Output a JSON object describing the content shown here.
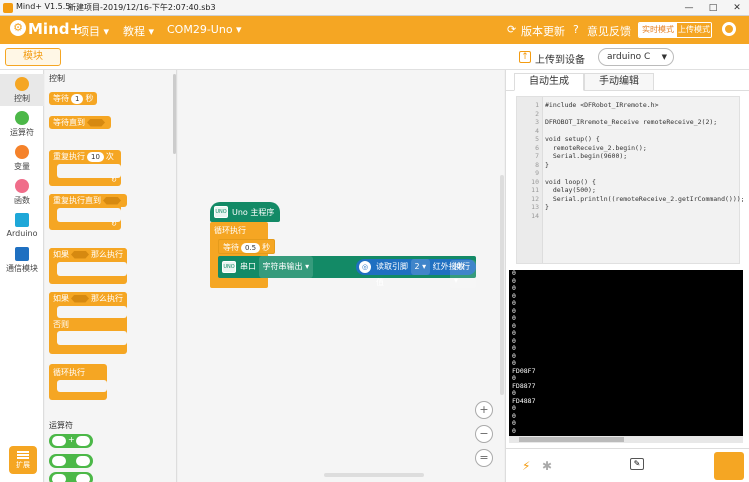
{
  "titlebar": {
    "app": "Mind+ V1.5.5",
    "project": "新建项目-2019/12/16-下午2:07:40.sb3",
    "min": "—",
    "max": "□",
    "close": "✕"
  },
  "menubar": {
    "logo": "Mind+",
    "project_menu": "项目 ▾",
    "tutorial_menu": "教程 ▾",
    "port_menu": "COM29-Uno ▾",
    "update": "版本更新",
    "feedback": "意见反馈",
    "mode_realtime": "实时模式",
    "mode_upload": "上传模式"
  },
  "subbar": {
    "module_tab": "模块",
    "upload": "上传到设备",
    "board": "arduino C"
  },
  "categories": [
    {
      "label": "控制",
      "color": "#f5a623"
    },
    {
      "label": "运算符",
      "color": "#4cb848"
    },
    {
      "label": "变量",
      "color": "#f5822a"
    },
    {
      "label": "函数",
      "color": "#f06d8a"
    },
    {
      "label": "Arduino",
      "color": "#1ea7d8"
    },
    {
      "label": "通信模块",
      "color": "#1f70c1"
    }
  ],
  "extension": "扩展",
  "palette": {
    "section_control": "控制",
    "wait": "等待",
    "wait_value": "1",
    "wait_unit": "秒",
    "wait_until": "等待直到",
    "repeat": "重复执行",
    "repeat_value": "10",
    "repeat_unit": "次",
    "repeat_until": "重复执行直到",
    "if_then": "如果",
    "then": "那么执行",
    "if_else_if": "如果",
    "else_then": "那么执行",
    "else": "否则",
    "forever": "循环执行",
    "section_operators": "运算符",
    "op_plus": "+"
  },
  "workspace": {
    "main_hat": "Uno 主程序",
    "forever": "循环执行",
    "wait": "等待",
    "wait_value": "0.5",
    "wait_unit": "秒",
    "serial": "串口",
    "serial_output": "字符串输出 ▾",
    "ir_read": "读取引脚",
    "ir_pin": "2 ▾",
    "ir_recv": "红外接收值",
    "newline": "换行 ▾",
    "zoom_in": "+",
    "zoom_out": "−",
    "zoom_reset": "="
  },
  "right_panel": {
    "tab_auto": "自动生成",
    "tab_manual": "手动编辑",
    "code_lines": [
      "#include <DFRobot_IRremote.h>",
      "",
      "DFROBOT_IRremote_Receive remoteReceive_2(2);",
      "",
      "void setup() {",
      "  remoteReceive_2.begin();",
      "  Serial.begin(9600);",
      "}",
      "",
      "void loop() {",
      "  delay(500);",
      "  Serial.println((remoteReceive_2.getIrCommand()));",
      "}",
      ""
    ],
    "serial_lines": [
      "0",
      "0",
      "0",
      "0",
      "0",
      "0",
      "0",
      "0",
      "0",
      "0",
      "0",
      "0",
      "0",
      "FD08F7",
      "0",
      "FD8877",
      "0",
      "FD4887",
      "0",
      "0",
      "0",
      "0"
    ]
  }
}
